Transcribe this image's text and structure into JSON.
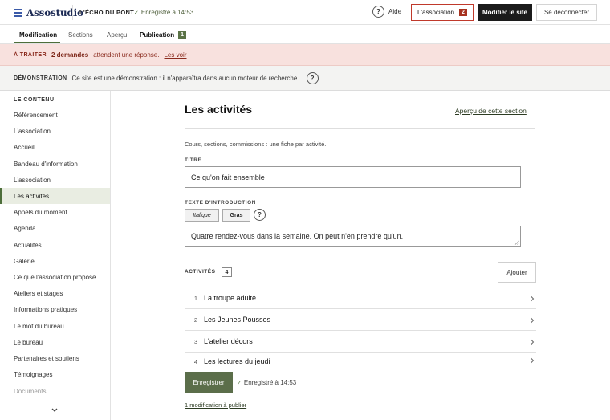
{
  "topbar": {
    "brand": "Assostudio",
    "site_name": "L'ÉCHO DU PONT",
    "saved_status": "Enregistré à 14:53",
    "help_label": "Aide",
    "help_icon_glyph": "?",
    "association_label": "L'association",
    "association_badge": "2",
    "modify_label": "Modifier le site",
    "logout_label": "Se déconnecter"
  },
  "tabs": [
    {
      "label": "Modification",
      "active": true
    },
    {
      "label": "Sections",
      "active": false
    },
    {
      "label": "Aperçu",
      "active": false
    },
    {
      "label": "Publication",
      "active": false,
      "badge": "1"
    }
  ],
  "alert": {
    "tag": "À TRAITER",
    "count": "2 demandes",
    "text": "attendent une réponse.",
    "link": "Les voir"
  },
  "demo": {
    "tag": "DÉMONSTRATION",
    "text": "Ce site est une démonstration : il n'apparaîtra dans aucun moteur de recherche.",
    "help_glyph": "?"
  },
  "sidebar": {
    "heading": "LE CONTENU",
    "items": [
      {
        "label": "Référencement"
      },
      {
        "label": "L'association"
      },
      {
        "label": "Accueil"
      },
      {
        "label": "Bandeau d'information"
      },
      {
        "label": "L'association"
      },
      {
        "label": "Les activités",
        "active": true
      },
      {
        "label": "Appels du moment"
      },
      {
        "label": "Agenda"
      },
      {
        "label": "Actualités"
      },
      {
        "label": "Galerie"
      },
      {
        "label": "Ce que l'association propose"
      },
      {
        "label": "Ateliers et stages"
      },
      {
        "label": "Informations pratiques"
      },
      {
        "label": "Le mot du bureau"
      },
      {
        "label": "Le bureau"
      },
      {
        "label": "Partenaires et soutiens"
      },
      {
        "label": "Témoignages"
      },
      {
        "label": "Documents",
        "muted": true
      }
    ]
  },
  "main": {
    "title": "Les activités",
    "preview_link": "Aperçu de cette section",
    "description": "Cours, sections, commissions : une fiche par activité.",
    "title_label": "TITRE",
    "title_value": "Ce qu'on fait ensemble",
    "intro_label": "TEXTE D'INTRODUCTION",
    "italic_label": "Italique",
    "bold_label": "Gras",
    "format_help_glyph": "?",
    "intro_value": "Quatre rendez-vous dans la semaine. On peut n'en prendre qu'un.",
    "activities_label": "ACTIVITÉS",
    "activities_count": "4",
    "add_label": "Ajouter",
    "activities": [
      {
        "num": "1",
        "name": "La troupe adulte"
      },
      {
        "num": "2",
        "name": "Les Jeunes Pousses"
      },
      {
        "num": "3",
        "name": "L'atelier décors"
      },
      {
        "num": "4",
        "name": "Les lectures du jeudi"
      }
    ],
    "save_label": "Enregistrer",
    "saved_status": "Enregistré à 14:53",
    "publish_link": "1 modification à publier"
  },
  "colors": {
    "accent_green": "#5b6e4a",
    "alert_bg": "#f8e1de",
    "alert_red": "#a7321f",
    "brand_blue": "#3b5aa8"
  }
}
